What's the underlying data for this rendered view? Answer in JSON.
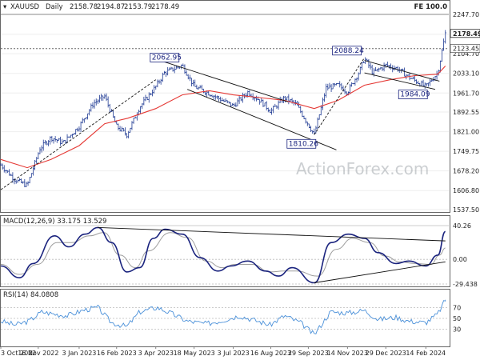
{
  "chart_data": {
    "type": "candlestick",
    "symbol": "XAUUSD",
    "timeframe": "Daily",
    "ohlc_readout": {
      "open": "2158.78",
      "high": "2194.87",
      "low": "2153.79",
      "close": "2178.49"
    },
    "watermark": "ActionForex.com",
    "fe_label": "FE 100.0",
    "x_ticks": [
      "3 Oct 2022",
      "16 Nov 2022",
      "3 Jan 2023",
      "16 Feb 2023",
      "3 Apr 2023",
      "18 May 2023",
      "3 Jul 2023",
      "16 Aug 2023",
      "29 Sep 2023",
      "14 Nov 2023",
      "29 Dec 2023",
      "14 Feb 2024"
    ],
    "price_panel": {
      "ylim": [
        1537.5,
        2247.7
      ],
      "y_ticks": [
        2247.7,
        2175.35,
        2104.7,
        2033.1,
        1961.7,
        1892.55,
        1821.0,
        1749.75,
        1678.2,
        1606.8,
        1537.5
      ],
      "y_tick_labels": [
        "2247.70",
        "2175.35",
        "2104.70",
        "2033.10",
        "1961.70",
        "1892.55",
        "1821.00",
        "1749.75",
        "1678.20",
        "1606.80",
        "1537.50"
      ],
      "current_price": {
        "value": 2178.49,
        "label": "2178.49"
      },
      "level_line": {
        "value": 2123.45,
        "label": "2123.45"
      },
      "fe_level": 2247.7,
      "annotations": [
        {
          "label": "2062.95",
          "date": "2023-05-04",
          "value": 2062.95
        },
        {
          "label": "1810.26",
          "date": "2023-10-06",
          "value": 1810.26
        },
        {
          "label": "2088.24",
          "date": "2023-12-04",
          "value": 2088.24
        },
        {
          "label": "1984.09",
          "date": "2024-02-14",
          "value": 1984.09
        }
      ],
      "close_series": [
        [
          "2022-10-03",
          1700
        ],
        [
          "2022-10-20",
          1645
        ],
        [
          "2022-11-03",
          1625
        ],
        [
          "2022-11-18",
          1760
        ],
        [
          "2022-12-01",
          1800
        ],
        [
          "2022-12-15",
          1780
        ],
        [
          "2023-01-03",
          1840
        ],
        [
          "2023-01-20",
          1925
        ],
        [
          "2023-02-02",
          1950
        ],
        [
          "2023-02-16",
          1840
        ],
        [
          "2023-02-28",
          1810
        ],
        [
          "2023-03-15",
          1910
        ],
        [
          "2023-04-03",
          1985
        ],
        [
          "2023-04-13",
          2035
        ],
        [
          "2023-05-04",
          2062.95
        ],
        [
          "2023-05-18",
          1985
        ],
        [
          "2023-06-05",
          1960
        ],
        [
          "2023-06-20",
          1935
        ],
        [
          "2023-07-03",
          1915
        ],
        [
          "2023-07-20",
          1965
        ],
        [
          "2023-08-03",
          1935
        ],
        [
          "2023-08-16",
          1895
        ],
        [
          "2023-09-01",
          1945
        ],
        [
          "2023-09-15",
          1920
        ],
        [
          "2023-10-06",
          1810.26
        ],
        [
          "2023-10-20",
          1980
        ],
        [
          "2023-11-03",
          1990
        ],
        [
          "2023-11-14",
          1965
        ],
        [
          "2023-11-28",
          2040
        ],
        [
          "2023-12-04",
          2088.24
        ],
        [
          "2023-12-14",
          2035
        ],
        [
          "2023-12-29",
          2063
        ],
        [
          "2024-01-12",
          2050
        ],
        [
          "2024-01-25",
          2020
        ],
        [
          "2024-02-14",
          1984.09
        ],
        [
          "2024-02-28",
          2035
        ],
        [
          "2024-03-05",
          2130
        ],
        [
          "2024-03-08",
          2178.49
        ]
      ],
      "moving_average": [
        [
          "2022-10-03",
          1720
        ],
        [
          "2022-11-03",
          1690
        ],
        [
          "2022-12-01",
          1720
        ],
        [
          "2023-01-03",
          1770
        ],
        [
          "2023-02-02",
          1850
        ],
        [
          "2023-03-01",
          1870
        ],
        [
          "2023-04-03",
          1905
        ],
        [
          "2023-05-04",
          1955
        ],
        [
          "2023-06-05",
          1970
        ],
        [
          "2023-07-03",
          1955
        ],
        [
          "2023-08-03",
          1945
        ],
        [
          "2023-09-01",
          1935
        ],
        [
          "2023-10-06",
          1905
        ],
        [
          "2023-11-03",
          1935
        ],
        [
          "2023-12-04",
          1990
        ],
        [
          "2024-01-03",
          2010
        ],
        [
          "2024-02-01",
          2025
        ],
        [
          "2024-02-28",
          2030
        ],
        [
          "2024-03-08",
          2060
        ]
      ],
      "trend_lines": [
        {
          "from": [
            "2023-04-13",
            2075
          ],
          "to": [
            "2023-09-05",
            1930
          ]
        },
        {
          "from": [
            "2023-05-10",
            1975
          ],
          "to": [
            "2023-11-01",
            1755
          ]
        },
        {
          "from": [
            "2023-10-06",
            1810
          ],
          "to": [
            "2023-12-04",
            2090
          ]
        },
        {
          "from": [
            "2023-12-04",
            2080
          ],
          "to": [
            "2024-03-01",
            2005
          ]
        },
        {
          "from": [
            "2023-12-04",
            2035
          ],
          "to": [
            "2024-02-25",
            1975
          ]
        },
        {
          "from": [
            "2022-10-03",
            1610
          ],
          "to": [
            "2023-04-03",
            2010
          ]
        }
      ]
    },
    "macd_panel": {
      "label": "MACD(12,26,9) 33.175 13.529",
      "ylim": [
        -29.438,
        40.26
      ],
      "y_ticks": [
        40.26,
        0.0,
        -29.438
      ],
      "y_tick_labels": [
        "40.26",
        "0.00",
        "-29.438"
      ],
      "macd_series": [
        [
          "2022-10-03",
          -8
        ],
        [
          "2022-10-25",
          -22
        ],
        [
          "2022-11-10",
          -5
        ],
        [
          "2022-12-05",
          28
        ],
        [
          "2022-12-22",
          15
        ],
        [
          "2023-01-10",
          30
        ],
        [
          "2023-01-25",
          38
        ],
        [
          "2023-02-10",
          20
        ],
        [
          "2023-02-28",
          -15
        ],
        [
          "2023-03-15",
          -10
        ],
        [
          "2023-03-31",
          25
        ],
        [
          "2023-04-14",
          36
        ],
        [
          "2023-05-04",
          30
        ],
        [
          "2023-05-25",
          2
        ],
        [
          "2023-06-15",
          -14
        ],
        [
          "2023-06-30",
          -8
        ],
        [
          "2023-07-20",
          -2
        ],
        [
          "2023-08-10",
          -14
        ],
        [
          "2023-08-25",
          -20
        ],
        [
          "2023-09-10",
          -10
        ],
        [
          "2023-10-06",
          -28
        ],
        [
          "2023-10-26",
          20
        ],
        [
          "2023-11-15",
          30
        ],
        [
          "2023-12-04",
          25
        ],
        [
          "2023-12-20",
          8
        ],
        [
          "2024-01-10",
          -5
        ],
        [
          "2024-01-25",
          -2
        ],
        [
          "2024-02-14",
          -8
        ],
        [
          "2024-02-28",
          5
        ],
        [
          "2024-03-08",
          33.175
        ]
      ],
      "signal_series": [
        [
          "2022-10-03",
          -6
        ],
        [
          "2022-10-25",
          -18
        ],
        [
          "2022-11-15",
          -6
        ],
        [
          "2022-12-08",
          20
        ],
        [
          "2022-12-25",
          20
        ],
        [
          "2023-01-15",
          28
        ],
        [
          "2023-02-01",
          32
        ],
        [
          "2023-02-20",
          5
        ],
        [
          "2023-03-10",
          -10
        ],
        [
          "2023-03-25",
          10
        ],
        [
          "2023-04-20",
          32
        ],
        [
          "2023-05-10",
          26
        ],
        [
          "2023-06-01",
          -2
        ],
        [
          "2023-06-20",
          -10
        ],
        [
          "2023-07-05",
          -6
        ],
        [
          "2023-07-25",
          -6
        ],
        [
          "2023-08-15",
          -15
        ],
        [
          "2023-09-01",
          -14
        ],
        [
          "2023-09-15",
          -14
        ],
        [
          "2023-10-10",
          -20
        ],
        [
          "2023-11-01",
          12
        ],
        [
          "2023-11-20",
          25
        ],
        [
          "2023-12-10",
          20
        ],
        [
          "2023-12-28",
          4
        ],
        [
          "2024-01-15",
          -3
        ],
        [
          "2024-02-01",
          -5
        ],
        [
          "2024-02-20",
          -6
        ],
        [
          "2024-03-01",
          5
        ],
        [
          "2024-03-08",
          13.529
        ]
      ],
      "trend_lines": [
        {
          "from": [
            "2023-01-25",
            38
          ],
          "to": [
            "2024-03-08",
            22
          ]
        },
        {
          "from": [
            "2023-10-06",
            -28
          ],
          "to": [
            "2024-03-08",
            -3
          ]
        }
      ]
    },
    "rsi_panel": {
      "label": "RSI(14) 84.0808",
      "ylim": [
        0,
        100
      ],
      "y_ticks": [
        70,
        50,
        30
      ],
      "y_tick_labels": [
        "70",
        "50",
        "30"
      ],
      "rsi_series": [
        [
          "2022-10-03",
          45
        ],
        [
          "2022-10-20",
          38
        ],
        [
          "2022-11-05",
          45
        ],
        [
          "2022-11-20",
          62
        ],
        [
          "2022-12-05",
          58
        ],
        [
          "2022-12-20",
          55
        ],
        [
          "2023-01-10",
          66
        ],
        [
          "2023-01-25",
          70
        ],
        [
          "2023-02-10",
          42
        ],
        [
          "2023-02-28",
          35
        ],
        [
          "2023-03-15",
          62
        ],
        [
          "2023-04-05",
          70
        ],
        [
          "2023-04-20",
          60
        ],
        [
          "2023-05-10",
          45
        ],
        [
          "2023-06-01",
          40
        ],
        [
          "2023-06-20",
          46
        ],
        [
          "2023-07-10",
          55
        ],
        [
          "2023-07-25",
          48
        ],
        [
          "2023-08-15",
          38
        ],
        [
          "2023-09-01",
          55
        ],
        [
          "2023-09-20",
          42
        ],
        [
          "2023-10-06",
          20
        ],
        [
          "2023-10-25",
          62
        ],
        [
          "2023-11-15",
          60
        ],
        [
          "2023-12-04",
          65
        ],
        [
          "2023-12-20",
          48
        ],
        [
          "2024-01-10",
          52
        ],
        [
          "2024-01-25",
          45
        ],
        [
          "2024-02-14",
          42
        ],
        [
          "2024-02-28",
          58
        ],
        [
          "2024-03-08",
          84.0808
        ]
      ]
    }
  }
}
